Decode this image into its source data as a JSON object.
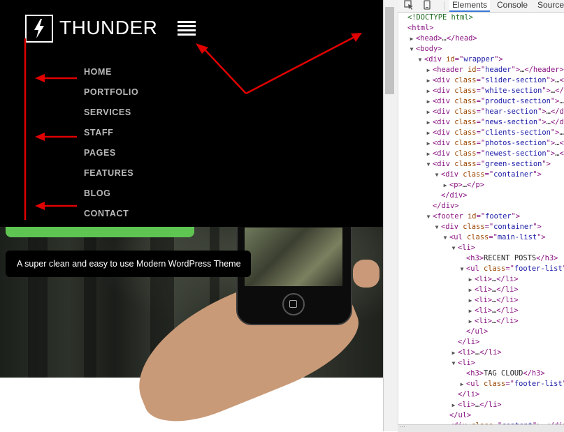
{
  "site": {
    "logo_text": "THUNDER",
    "nav_items": [
      "HOME",
      "PORTFOLIO",
      "SERVICES",
      "STAFF",
      "PAGES",
      "FEATURES",
      "BLOG",
      "CONTACT"
    ],
    "tagline": "A super clean and easy to use Modern WordPress Theme",
    "colors": {
      "header_bg": "#000000",
      "nav_text": "#b9b9b9",
      "accent_green": "#5fc552",
      "annotation_red": "#e00000"
    }
  },
  "devtools": {
    "tabs": [
      "Elements",
      "Console",
      "Sources"
    ],
    "active_tab": "Elements",
    "tree": [
      {
        "d": 0,
        "tri": "",
        "t": [
          [
            "cmt",
            "<!DOCTYPE html>"
          ]
        ]
      },
      {
        "d": 0,
        "tri": "",
        "t": [
          [
            "tag",
            "<html>"
          ]
        ]
      },
      {
        "d": 1,
        "tri": "▶",
        "t": [
          [
            "tag",
            "<head>"
          ],
          [
            "txt",
            "…"
          ],
          [
            "tag",
            "</head>"
          ]
        ]
      },
      {
        "d": 1,
        "tri": "▼",
        "t": [
          [
            "tag",
            "<body>"
          ]
        ]
      },
      {
        "d": 2,
        "tri": "▼",
        "t": [
          [
            "tag",
            "<div "
          ],
          [
            "attr",
            "id"
          ],
          [
            "tag",
            "=\""
          ],
          [
            "val",
            "wrapper"
          ],
          [
            "tag",
            "\">"
          ]
        ]
      },
      {
        "d": 3,
        "tri": "▶",
        "t": [
          [
            "tag",
            "<header "
          ],
          [
            "attr",
            "id"
          ],
          [
            "tag",
            "=\""
          ],
          [
            "val",
            "header"
          ],
          [
            "tag",
            "\">"
          ],
          [
            "txt",
            "…"
          ],
          [
            "tag",
            "</header>"
          ]
        ]
      },
      {
        "d": 3,
        "tri": "▶",
        "t": [
          [
            "tag",
            "<div "
          ],
          [
            "attr",
            "class"
          ],
          [
            "tag",
            "=\""
          ],
          [
            "val",
            "slider-section"
          ],
          [
            "tag",
            "\">"
          ],
          [
            "txt",
            "…"
          ],
          [
            "tag",
            "</div>"
          ]
        ]
      },
      {
        "d": 3,
        "tri": "▶",
        "t": [
          [
            "tag",
            "<div "
          ],
          [
            "attr",
            "class"
          ],
          [
            "tag",
            "=\""
          ],
          [
            "val",
            "white-section"
          ],
          [
            "tag",
            "\">"
          ],
          [
            "txt",
            "…"
          ],
          [
            "tag",
            "</div>"
          ]
        ]
      },
      {
        "d": 3,
        "tri": "▶",
        "t": [
          [
            "tag",
            "<div "
          ],
          [
            "attr",
            "class"
          ],
          [
            "tag",
            "=\""
          ],
          [
            "val",
            "product-section"
          ],
          [
            "tag",
            "\">"
          ],
          [
            "txt",
            "…"
          ],
          [
            "tag",
            "</div>"
          ]
        ]
      },
      {
        "d": 3,
        "tri": "▶",
        "t": [
          [
            "tag",
            "<div "
          ],
          [
            "attr",
            "class"
          ],
          [
            "tag",
            "=\""
          ],
          [
            "val",
            "hear-section"
          ],
          [
            "tag",
            "\">"
          ],
          [
            "txt",
            "…"
          ],
          [
            "tag",
            "</div>"
          ]
        ]
      },
      {
        "d": 3,
        "tri": "▶",
        "t": [
          [
            "tag",
            "<div "
          ],
          [
            "attr",
            "class"
          ],
          [
            "tag",
            "=\""
          ],
          [
            "val",
            "news-section"
          ],
          [
            "tag",
            "\">"
          ],
          [
            "txt",
            "…"
          ],
          [
            "tag",
            "</div>"
          ]
        ]
      },
      {
        "d": 3,
        "tri": "▶",
        "t": [
          [
            "tag",
            "<div "
          ],
          [
            "attr",
            "class"
          ],
          [
            "tag",
            "=\""
          ],
          [
            "val",
            "clients-section"
          ],
          [
            "tag",
            "\">"
          ],
          [
            "txt",
            "…"
          ],
          [
            "tag",
            "</div>"
          ]
        ]
      },
      {
        "d": 3,
        "tri": "▶",
        "t": [
          [
            "tag",
            "<div "
          ],
          [
            "attr",
            "class"
          ],
          [
            "tag",
            "=\""
          ],
          [
            "val",
            "photos-section"
          ],
          [
            "tag",
            "\">"
          ],
          [
            "txt",
            "…"
          ],
          [
            "tag",
            "</div>"
          ]
        ]
      },
      {
        "d": 3,
        "tri": "▶",
        "t": [
          [
            "tag",
            "<div "
          ],
          [
            "attr",
            "class"
          ],
          [
            "tag",
            "=\""
          ],
          [
            "val",
            "newest-section"
          ],
          [
            "tag",
            "\">"
          ],
          [
            "txt",
            "…"
          ],
          [
            "tag",
            "</div>"
          ]
        ]
      },
      {
        "d": 3,
        "tri": "▼",
        "t": [
          [
            "tag",
            "<div "
          ],
          [
            "attr",
            "class"
          ],
          [
            "tag",
            "=\""
          ],
          [
            "val",
            "green-section"
          ],
          [
            "tag",
            "\">"
          ]
        ]
      },
      {
        "d": 4,
        "tri": "▼",
        "t": [
          [
            "tag",
            "<div "
          ],
          [
            "attr",
            "class"
          ],
          [
            "tag",
            "=\""
          ],
          [
            "val",
            "container"
          ],
          [
            "tag",
            "\">"
          ]
        ]
      },
      {
        "d": 5,
        "tri": "▶",
        "t": [
          [
            "tag",
            "<p>"
          ],
          [
            "txt",
            "…"
          ],
          [
            "tag",
            "</p>"
          ]
        ]
      },
      {
        "d": 4,
        "tri": "",
        "t": [
          [
            "tag",
            "</div>"
          ]
        ]
      },
      {
        "d": 3,
        "tri": "",
        "t": [
          [
            "tag",
            "</div>"
          ]
        ]
      },
      {
        "d": 3,
        "tri": "▼",
        "t": [
          [
            "tag",
            "<footer "
          ],
          [
            "attr",
            "id"
          ],
          [
            "tag",
            "=\""
          ],
          [
            "val",
            "footer"
          ],
          [
            "tag",
            "\">"
          ]
        ]
      },
      {
        "d": 4,
        "tri": "▼",
        "t": [
          [
            "tag",
            "<div "
          ],
          [
            "attr",
            "class"
          ],
          [
            "tag",
            "=\""
          ],
          [
            "val",
            "container"
          ],
          [
            "tag",
            "\">"
          ]
        ]
      },
      {
        "d": 5,
        "tri": "▼",
        "t": [
          [
            "tag",
            "<ul "
          ],
          [
            "attr",
            "class"
          ],
          [
            "tag",
            "=\""
          ],
          [
            "val",
            "main-list"
          ],
          [
            "tag",
            "\">"
          ]
        ]
      },
      {
        "d": 6,
        "tri": "▼",
        "t": [
          [
            "tag",
            "<li>"
          ]
        ]
      },
      {
        "d": 7,
        "tri": "",
        "t": [
          [
            "tag",
            "<h3>"
          ],
          [
            "txt",
            "RECENT POSTS"
          ],
          [
            "tag",
            "</h3>"
          ]
        ]
      },
      {
        "d": 7,
        "tri": "▼",
        "t": [
          [
            "tag",
            "<ul "
          ],
          [
            "attr",
            "class"
          ],
          [
            "tag",
            "=\""
          ],
          [
            "val",
            "footer-list"
          ],
          [
            "tag",
            "\">"
          ]
        ]
      },
      {
        "d": 8,
        "tri": "▶",
        "t": [
          [
            "tag",
            "<li>"
          ],
          [
            "txt",
            "…"
          ],
          [
            "tag",
            "</li>"
          ]
        ]
      },
      {
        "d": 8,
        "tri": "▶",
        "t": [
          [
            "tag",
            "<li>"
          ],
          [
            "txt",
            "…"
          ],
          [
            "tag",
            "</li>"
          ]
        ]
      },
      {
        "d": 8,
        "tri": "▶",
        "t": [
          [
            "tag",
            "<li>"
          ],
          [
            "txt",
            "…"
          ],
          [
            "tag",
            "</li>"
          ]
        ]
      },
      {
        "d": 8,
        "tri": "▶",
        "t": [
          [
            "tag",
            "<li>"
          ],
          [
            "txt",
            "…"
          ],
          [
            "tag",
            "</li>"
          ]
        ]
      },
      {
        "d": 8,
        "tri": "▶",
        "t": [
          [
            "tag",
            "<li>"
          ],
          [
            "txt",
            "…"
          ],
          [
            "tag",
            "</li>"
          ]
        ]
      },
      {
        "d": 7,
        "tri": "",
        "t": [
          [
            "tag",
            "</ul>"
          ]
        ]
      },
      {
        "d": 6,
        "tri": "",
        "t": [
          [
            "tag",
            "</li>"
          ]
        ]
      },
      {
        "d": 6,
        "tri": "▶",
        "t": [
          [
            "tag",
            "<li>"
          ],
          [
            "txt",
            "…"
          ],
          [
            "tag",
            "</li>"
          ]
        ]
      },
      {
        "d": 6,
        "tri": "▼",
        "t": [
          [
            "tag",
            "<li>"
          ]
        ]
      },
      {
        "d": 7,
        "tri": "",
        "t": [
          [
            "tag",
            "<h3>"
          ],
          [
            "txt",
            "TAG CLOUD"
          ],
          [
            "tag",
            "</h3>"
          ]
        ]
      },
      {
        "d": 7,
        "tri": "▶",
        "t": [
          [
            "tag",
            "<ul "
          ],
          [
            "attr",
            "class"
          ],
          [
            "tag",
            "=\""
          ],
          [
            "val",
            "footer-list"
          ],
          [
            "tag",
            "\">"
          ],
          [
            "txt",
            "…"
          ],
          [
            "tag",
            "</ul>"
          ]
        ]
      },
      {
        "d": 6,
        "tri": "",
        "t": [
          [
            "tag",
            "</li>"
          ]
        ]
      },
      {
        "d": 6,
        "tri": "▶",
        "t": [
          [
            "tag",
            "<li>"
          ],
          [
            "txt",
            "…"
          ],
          [
            "tag",
            "</li>"
          ]
        ]
      },
      {
        "d": 5,
        "tri": "",
        "t": [
          [
            "tag",
            "</ul>"
          ]
        ]
      },
      {
        "d": 5,
        "tri": "▶",
        "t": [
          [
            "tag",
            "<div "
          ],
          [
            "attr",
            "class"
          ],
          [
            "tag",
            "=\""
          ],
          [
            "val",
            "content"
          ],
          [
            "tag",
            "\">"
          ],
          [
            "txt",
            "…"
          ],
          [
            "tag",
            "</div>"
          ]
        ]
      }
    ]
  }
}
